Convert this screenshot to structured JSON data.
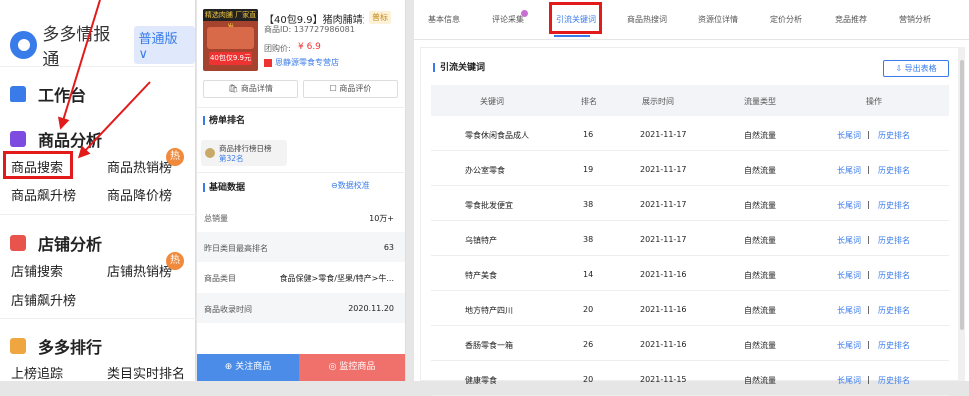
{
  "left_nav": {
    "logo_text": "多多情报通",
    "version": "普通版 ∨",
    "sections": [
      {
        "title": "工作台",
        "icon": "home-icon"
      },
      {
        "title": "商品分析",
        "icon": "bag-icon",
        "items": [
          "商品搜索",
          "商品热销榜",
          "商品飙升榜",
          "商品降价榜"
        ]
      },
      {
        "title": "店铺分析",
        "icon": "store-icon",
        "items": [
          "店铺搜索",
          "店铺热销榜",
          "店铺飙升榜"
        ]
      },
      {
        "title": "多多排行",
        "icon": "ranking-icon",
        "items": [
          "上榜追踪",
          "类目实时排名"
        ]
      }
    ],
    "hot_label": "热"
  },
  "product": {
    "image_band_text": "精选肉脯 厂家直发",
    "image_badge_text": "40包仅9.9元",
    "title": "【40包9.9】猪肉脯靖江...",
    "id_text": "商品ID: 137727986081",
    "tag": "普标",
    "price_label": "团购价:",
    "price": "¥ 6.9",
    "store": "恩静源零食专营店",
    "btn_detail": "商品详情",
    "btn_review": "商品评价",
    "rank_section": "榜单排名",
    "rank_card_title": "商品排行榜日榜",
    "rank_card_value": "第32名",
    "basic_section": "基础数据",
    "calibrate": "数据校准",
    "fields": [
      {
        "k": "总销量",
        "v": "10万+"
      },
      {
        "k": "昨日类目最高排名",
        "v": "63"
      },
      {
        "k": "商品类目",
        "v": "食品保健>零食/坚果/特产>牛..."
      },
      {
        "k": "商品收录时间",
        "v": "2020.11.20"
      }
    ],
    "follow_btn": "关注商品",
    "monitor_btn": "监控商品"
  },
  "tabs": [
    "基本信息",
    "评论采集",
    "引流关键词",
    "商品热搜词",
    "资源位详情",
    "定价分析",
    "竞品推荐",
    "营销分析"
  ],
  "active_tab": "引流关键词",
  "table": {
    "title": "引流关键词",
    "export": "导出表格",
    "headers": [
      "关键词",
      "排名",
      "展示时间",
      "流量类型",
      "操作"
    ],
    "rows": [
      {
        "kw": "零食休闲食品成人",
        "rank": "16",
        "date": "2021-11-17",
        "type": "自然流量",
        "op1": "长尾词",
        "sep": "|",
        "op2": "历史排名"
      },
      {
        "kw": "办公室零食",
        "rank": "19",
        "date": "2021-11-17",
        "type": "自然流量",
        "op1": "长尾词",
        "sep": "|",
        "op2": "历史排名"
      },
      {
        "kw": "零食批发便宜",
        "rank": "38",
        "date": "2021-11-17",
        "type": "自然流量",
        "op1": "长尾词",
        "sep": "|",
        "op2": "历史排名"
      },
      {
        "kw": "乌镇特产",
        "rank": "38",
        "date": "2021-11-17",
        "type": "自然流量",
        "op1": "长尾词",
        "sep": "|",
        "op2": "历史排名"
      },
      {
        "kw": "特产美食",
        "rank": "14",
        "date": "2021-11-16",
        "type": "自然流量",
        "op1": "长尾词",
        "sep": "|",
        "op2": "历史排名"
      },
      {
        "kw": "地方特产四川",
        "rank": "20",
        "date": "2021-11-16",
        "type": "自然流量",
        "op1": "长尾词",
        "sep": "|",
        "op2": "历史排名"
      },
      {
        "kw": "香肠零食一箱",
        "rank": "26",
        "date": "2021-11-16",
        "type": "自然流量",
        "op1": "长尾词",
        "sep": "|",
        "op2": "历史排名"
      },
      {
        "kw": "健康零食",
        "rank": "20",
        "date": "2021-11-15",
        "type": "自然流量",
        "op1": "长尾词",
        "sep": "|",
        "op2": "历史排名"
      }
    ]
  },
  "colors": {
    "accent": "#3a7bea",
    "highlight": "#e21a1a",
    "hot": "#f08a3c"
  }
}
